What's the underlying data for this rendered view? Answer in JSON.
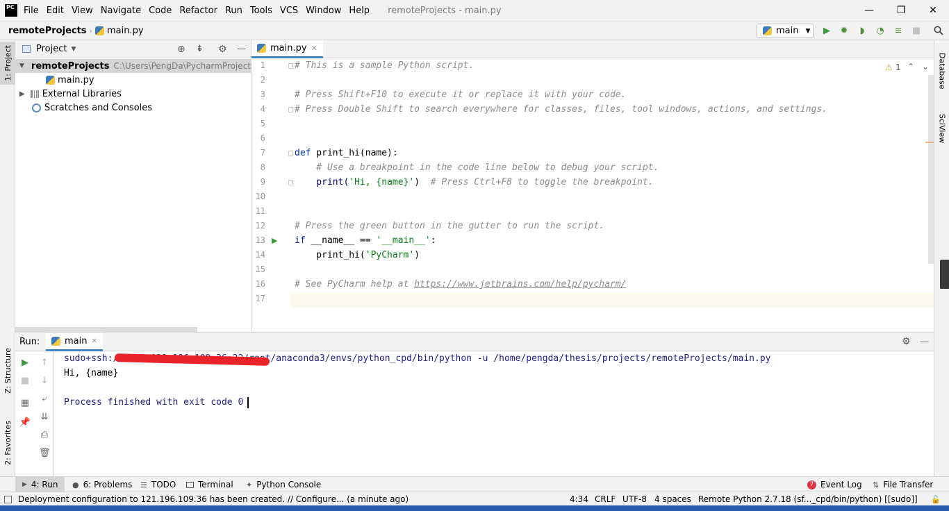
{
  "menubar": {
    "logo": "PC",
    "items": [
      "File",
      "Edit",
      "View",
      "Navigate",
      "Code",
      "Refactor",
      "Run",
      "Tools",
      "VCS",
      "Window",
      "Help"
    ],
    "window_title": "remoteProjects - main.py",
    "controls": {
      "minimize": "—",
      "restore": "❐",
      "close": "✕"
    }
  },
  "navbar": {
    "project": "remoteProjects",
    "file": "main.py",
    "run_config": "main"
  },
  "left_stripe": {
    "project_tab": "1: Project",
    "structure_tab": "Z: Structure",
    "favorites_tab": "2: Favorites"
  },
  "right_stripe": {
    "database_tab": "Database",
    "sciview_tab": "SciView"
  },
  "project_panel": {
    "title": "Project",
    "root_name": "remoteProjects",
    "root_path": "C:\\Users\\PengDa\\PycharmProjects",
    "file": "main.py",
    "external_libraries": "External Libraries",
    "scratches": "Scratches and Consoles"
  },
  "editor": {
    "tab": "main.py",
    "warnings": "1",
    "line_numbers": [
      "1",
      "2",
      "3",
      "4",
      "5",
      "6",
      "7",
      "8",
      "9",
      "10",
      "11",
      "12",
      "13",
      "14",
      "15",
      "16",
      "17"
    ],
    "lines": {
      "l1": "# This is a sample Python script.",
      "l3": "# Press Shift+F10 to execute it or replace it with your code.",
      "l4": "# Press Double Shift to search everywhere for classes, files, tool windows, actions, and settings.",
      "l7_kw": "def",
      "l7_rest": " print_hi(name):",
      "l8": "    # Use a breakpoint in the code line below to debug your script.",
      "l9_a": "    print(",
      "l9_str": "'Hi, {name}'",
      "l9_b": ")  ",
      "l9_cmt": "# Press Ctrl+F8 to toggle the breakpoint.",
      "l12": "# Press the green button in the gutter to run the script.",
      "l13_kw": "if",
      "l13_mid": " __name__ == ",
      "l13_str": "'__main__'",
      "l13_end": ":",
      "l14_a": "    print_hi(",
      "l14_str": "'PyCharm'",
      "l14_b": ")",
      "l16_cmt": "# See PyCharm help at ",
      "l16_link": "https://www.jetbrains.com/help/pycharm/"
    }
  },
  "run_window": {
    "label": "Run:",
    "tab": "main",
    "output": [
      "sudo+ssh://root@121.196.109.36:22/root/anaconda3/envs/python_cpd/bin/python -u /home/pengda/thesis/projects/remoteProjects/main.py",
      "Hi, {name}",
      "",
      "Process finished with exit code 0"
    ]
  },
  "bottom_tabs": {
    "run": "4: Run",
    "problems": "6: Problems",
    "todo": "TODO",
    "terminal": "Terminal",
    "python_console": "Python Console",
    "event_log_count": "7",
    "event_log": "Event Log",
    "file_transfer": "File Transfer"
  },
  "status_bar": {
    "message": "Deployment configuration to 121.196.109.36 has been created. // Configure... (a minute ago)",
    "position": "4:34",
    "line_sep": "CRLF",
    "encoding": "UTF-8",
    "indent": "4 spaces",
    "interpreter": "Remote Python 2.7.18 (sf..._cpd/bin/python) [[sudo]]"
  },
  "colors": {
    "accent": "#4083c9",
    "comment": "#8c8c8c",
    "keyword": "#0033b3",
    "string": "#067d17",
    "console_text": "#1f1f8a",
    "run_green": "#3c9a3c",
    "event_log_badge": "#d9363e"
  }
}
